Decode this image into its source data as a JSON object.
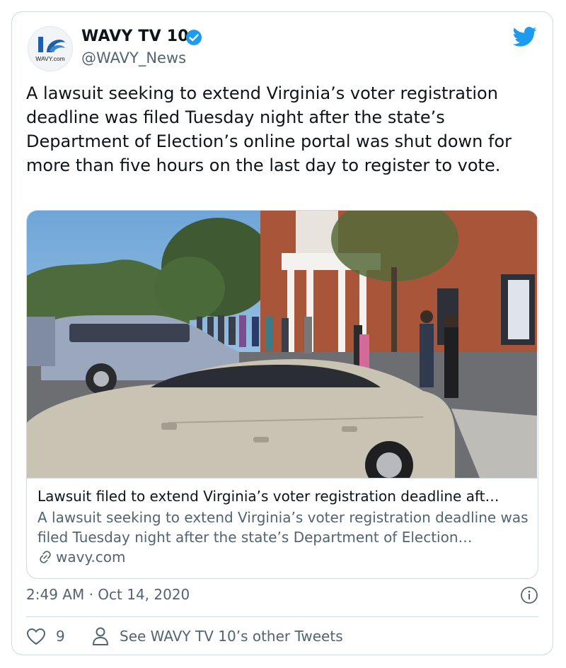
{
  "account": {
    "display_name": "WAVY TV 10",
    "handle": "@WAVY_News",
    "avatar_logo_text": "WAVY.com"
  },
  "tweet": {
    "text": "A lawsuit seeking to extend Virginia’s voter registration deadline was filed Tuesday night after the state’s Department of Election’s online portal was shut down for more than five hours on the last day to register to vote.",
    "timestamp": "2:49 AM · Oct 14, 2020",
    "like_count": "9"
  },
  "link_card": {
    "title": "Lawsuit filed to extend Virginia’s voter registration deadline aft…",
    "description": "A lawsuit seeking to extend Virginia’s voter registration deadline was filed Tuesday night after the state’s Department of Election…",
    "domain": "wavy.com"
  },
  "actions": {
    "other_tweets_label": "See WAVY TV 10’s other Tweets"
  },
  "colors": {
    "twitter_blue": "#1d9bf0",
    "text_primary": "#0f1419",
    "text_secondary": "#536471",
    "border": "#cfd9de",
    "brick": "#a8553a"
  },
  "icons": [
    "wavy-logo-icon",
    "verified-badge-icon",
    "twitter-bird-icon",
    "link-icon",
    "info-icon",
    "heart-icon",
    "person-icon"
  ]
}
